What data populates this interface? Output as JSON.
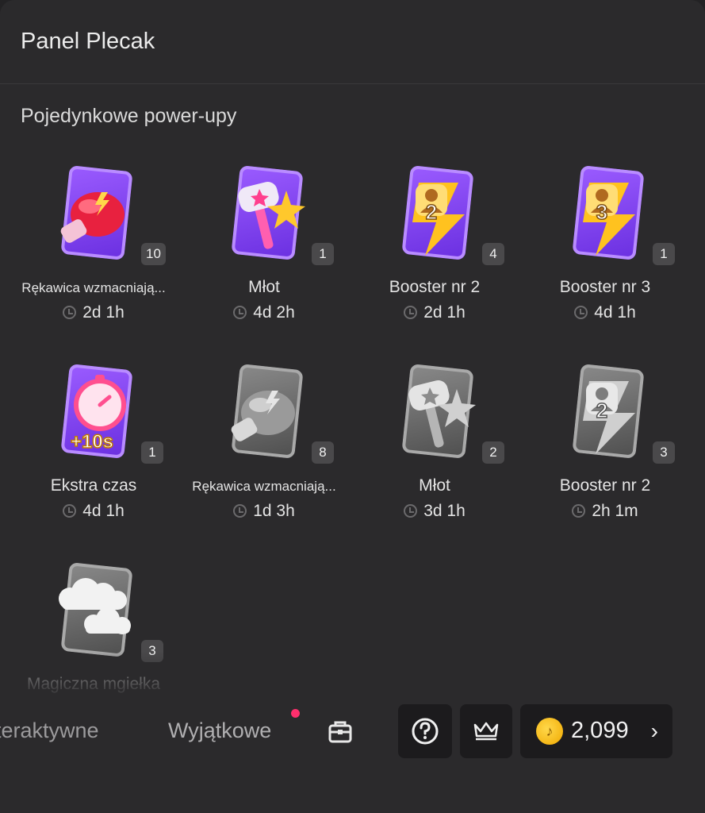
{
  "panel": {
    "title": "Panel Plecak",
    "section_title": "Pojedynkowe power-upy"
  },
  "items": [
    {
      "name": "Rękawica wzmacniają...",
      "time": "2d 1h",
      "count": "10",
      "icon": "boxing-glove-icon",
      "style": "purple"
    },
    {
      "name": "Młot",
      "time": "4d 2h",
      "count": "1",
      "icon": "hammer-icon",
      "style": "purple"
    },
    {
      "name": "Booster nr 2",
      "time": "2d 1h",
      "count": "4",
      "icon": "booster-2-icon",
      "style": "purple"
    },
    {
      "name": "Booster nr 3",
      "time": "4d 1h",
      "count": "1",
      "icon": "booster-3-icon",
      "style": "purple"
    },
    {
      "name": "Ekstra czas",
      "time": "4d 1h",
      "count": "1",
      "icon": "stopwatch-icon",
      "style": "purple"
    },
    {
      "name": "Rękawica wzmacniają...",
      "time": "1d 3h",
      "count": "8",
      "icon": "boxing-glove-icon",
      "style": "grey"
    },
    {
      "name": "Młot",
      "time": "3d 1h",
      "count": "2",
      "icon": "hammer-icon",
      "style": "grey"
    },
    {
      "name": "Booster nr 2",
      "time": "2h 1m",
      "count": "3",
      "icon": "booster-2-icon",
      "style": "grey"
    },
    {
      "name": "Magiczna mgiełka",
      "time": "",
      "count": "3",
      "icon": "cloud-icon",
      "style": "grey"
    }
  ],
  "bottom": {
    "tab_interactive": "teraktywne",
    "tab_special": "Wyjątkowe",
    "coins": "2,099",
    "help_icon": "help-icon",
    "crown_icon": "crown-icon",
    "bag_icon": "bag-icon"
  },
  "card_labels": {
    "booster2": "2",
    "booster3": "3",
    "extra_time": "+10s"
  },
  "colors": {
    "accent_dot": "#ff2f6d",
    "coin": "#f5b800",
    "card_purple": "#7b3cf0"
  }
}
